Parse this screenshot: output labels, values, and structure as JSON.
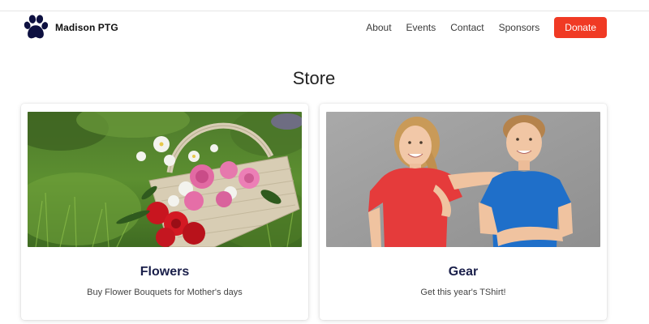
{
  "header": {
    "brand_name": "Madison PTG",
    "brand_icon": "paw-icon",
    "nav": [
      {
        "label": "About"
      },
      {
        "label": "Events"
      },
      {
        "label": "Contact"
      },
      {
        "label": "Sponsors"
      }
    ],
    "donate_label": "Donate"
  },
  "colors": {
    "donate_bg": "#f03a24",
    "card_title": "#1a1f4a",
    "paw": "#0d1040"
  },
  "page": {
    "title": "Store"
  },
  "cards": [
    {
      "title": "Flowers",
      "description": "Buy Flower Bouquets for Mother's days",
      "image": "flower-basket-photo"
    },
    {
      "title": "Gear",
      "description": "Get this year's TShirt!",
      "image": "kids-tshirts-photo"
    }
  ]
}
